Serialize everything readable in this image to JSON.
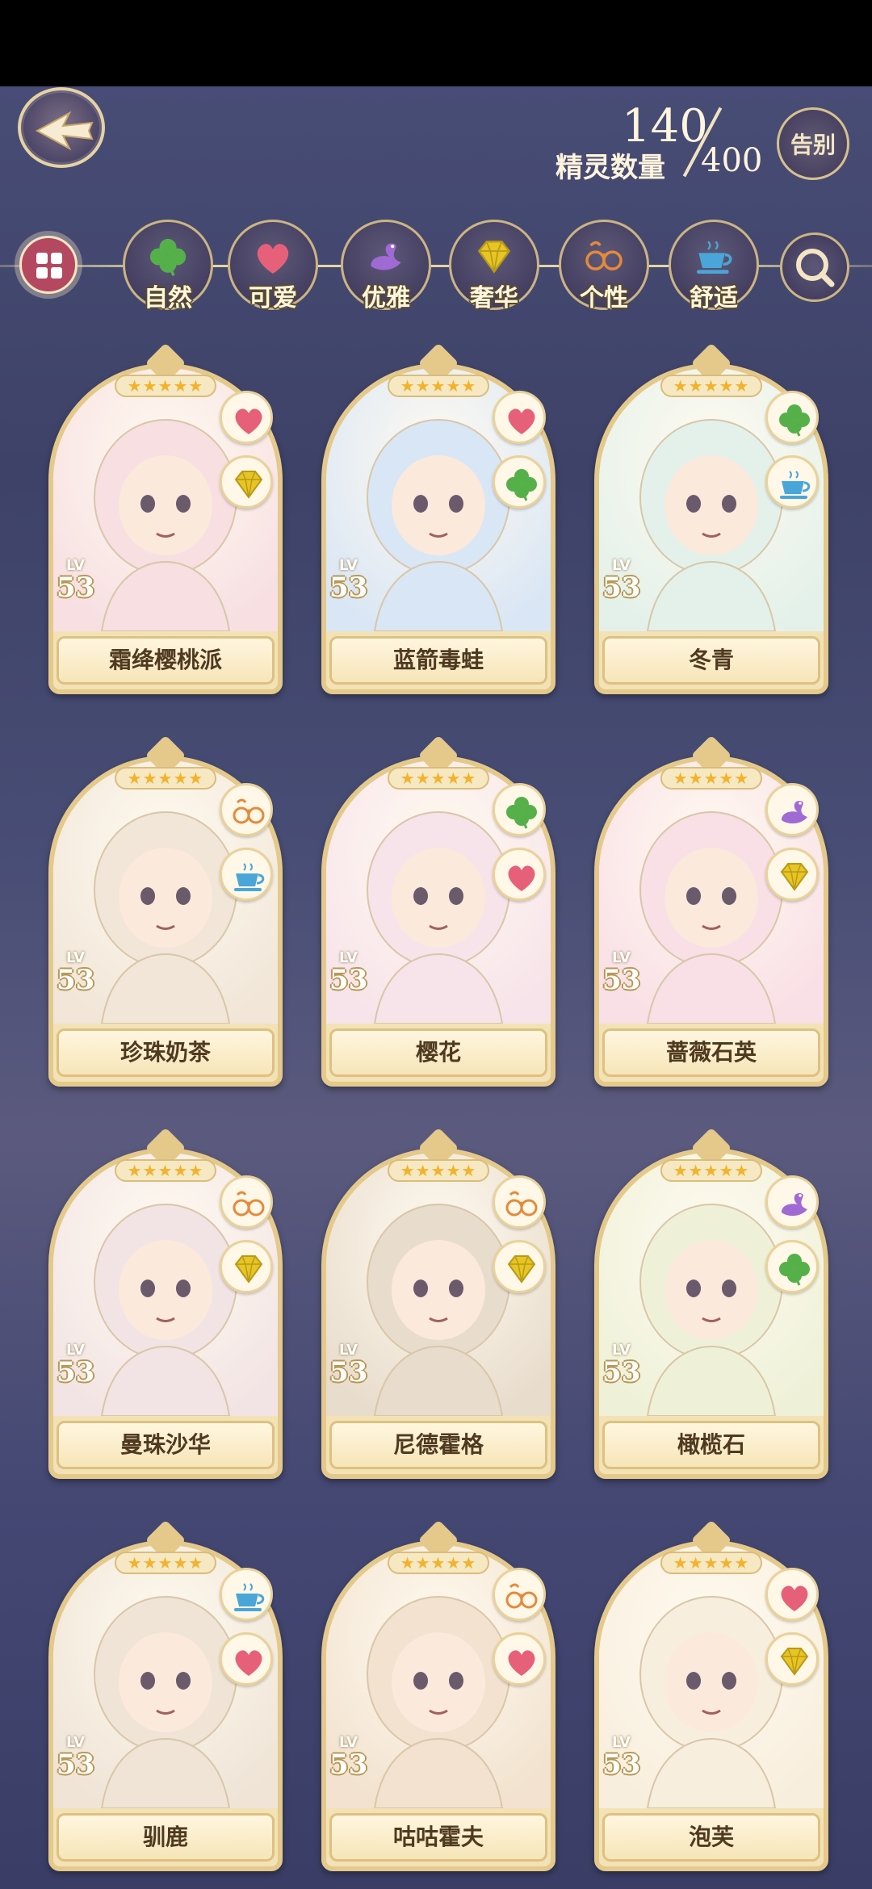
{
  "header": {
    "count_current": "140",
    "count_label": "精灵数量",
    "count_total": "400",
    "farewell_label": "告别"
  },
  "filters": [
    {
      "label": "自然",
      "icon": "clover-icon"
    },
    {
      "label": "可爱",
      "icon": "heart-icon"
    },
    {
      "label": "优雅",
      "icon": "swan-icon"
    },
    {
      "label": "奢华",
      "icon": "diamond-icon"
    },
    {
      "label": "个性",
      "icon": "glasses-icon"
    },
    {
      "label": "舒适",
      "icon": "teacup-icon"
    }
  ],
  "cards": [
    {
      "name": "霜绛樱桃派",
      "lv_label": "LV",
      "level": "53",
      "stars": "★★★★★",
      "attrs": [
        "heart-icon",
        "diamond-icon"
      ],
      "color": "#f7dfe2"
    },
    {
      "name": "蓝箭毒蛙",
      "lv_label": "LV",
      "level": "53",
      "stars": "★★★★★",
      "attrs": [
        "heart-icon",
        "clover-icon"
      ],
      "color": "#d9e6f5"
    },
    {
      "name": "冬青",
      "lv_label": "LV",
      "level": "53",
      "stars": "★★★★★",
      "attrs": [
        "clover-icon",
        "teacup-icon"
      ],
      "color": "#e3f1ea"
    },
    {
      "name": "珍珠奶茶",
      "lv_label": "LV",
      "level": "53",
      "stars": "★★★★★",
      "attrs": [
        "glasses-icon",
        "teacup-icon"
      ],
      "color": "#f1e6d8"
    },
    {
      "name": "樱花",
      "lv_label": "LV",
      "level": "53",
      "stars": "★★★★★",
      "attrs": [
        "clover-icon",
        "heart-icon"
      ],
      "color": "#f7e3ea"
    },
    {
      "name": "蔷薇石英",
      "lv_label": "LV",
      "level": "53",
      "stars": "★★★★★",
      "attrs": [
        "swan-icon",
        "diamond-icon"
      ],
      "color": "#f9dfe6"
    },
    {
      "name": "曼珠沙华",
      "lv_label": "LV",
      "level": "53",
      "stars": "★★★★★",
      "attrs": [
        "glasses-icon",
        "diamond-icon"
      ],
      "color": "#f2e4e4"
    },
    {
      "name": "尼德霍格",
      "lv_label": "LV",
      "level": "53",
      "stars": "★★★★★",
      "attrs": [
        "glasses-icon",
        "diamond-icon"
      ],
      "color": "#e8dccc"
    },
    {
      "name": "橄榄石",
      "lv_label": "LV",
      "level": "53",
      "stars": "★★★★★",
      "attrs": [
        "swan-icon",
        "clover-icon"
      ],
      "color": "#eef1d8"
    },
    {
      "name": "驯鹿",
      "lv_label": "LV",
      "level": "53",
      "stars": "★★★★★",
      "attrs": [
        "teacup-icon",
        "heart-icon"
      ],
      "color": "#efe4d6"
    },
    {
      "name": "咕咕霍夫",
      "lv_label": "LV",
      "level": "53",
      "stars": "★★★★★",
      "attrs": [
        "glasses-icon",
        "heart-icon"
      ],
      "color": "#f2e2cf"
    },
    {
      "name": "泡芙",
      "lv_label": "LV",
      "level": "53",
      "stars": "★★★★★",
      "attrs": [
        "heart-icon",
        "diamond-icon"
      ],
      "color": "#f8eedd"
    }
  ],
  "colors": {
    "gold": "#e4c98a",
    "heart": "#e7607a",
    "clover": "#56b04a",
    "diamond": "#e6c525",
    "swan": "#a06ad4",
    "glasses": "#e58a3a",
    "teacup": "#4aa6d8"
  }
}
